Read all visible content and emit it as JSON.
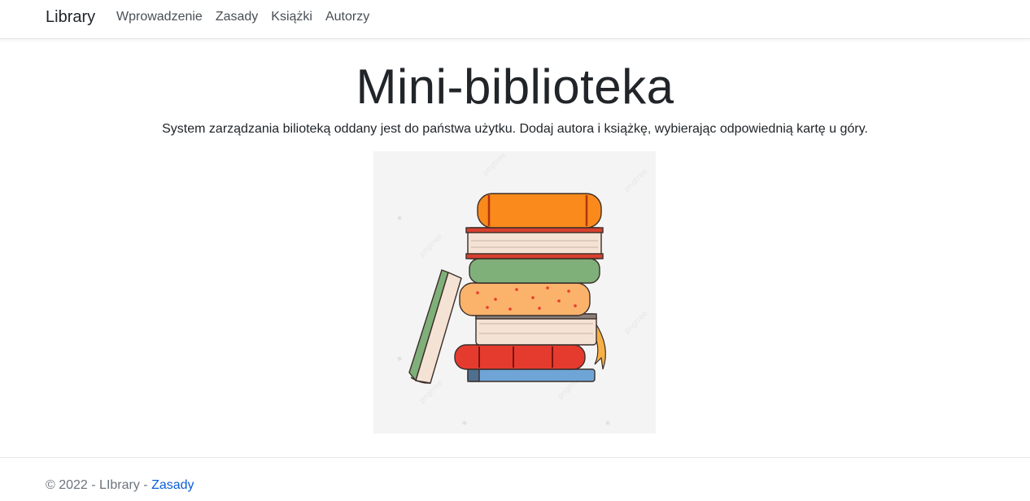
{
  "navbar": {
    "brand": "Library",
    "links": [
      {
        "label": "Wprowadzenie"
      },
      {
        "label": "Zasady"
      },
      {
        "label": "Książki"
      },
      {
        "label": "Autorzy"
      }
    ]
  },
  "main": {
    "title": "Mini-biblioteka",
    "lead": "System zarządzania bilioteką oddany jest do państwa użytku. Dodaj autora i książkę, wybierając odpowiednią kartę u góry.",
    "image": {
      "watermark": "pngtree",
      "colors": {
        "background": "#f4f4f4",
        "orange": "#f98a1b",
        "green": "#7fb07a",
        "peach": "#fbb26a",
        "red": "#e53b2e",
        "blue": "#6fa5d6",
        "pages": "#f4e2d4"
      }
    }
  },
  "footer": {
    "text": "© 2022 - LIbrary - ",
    "link_label": "Zasady"
  }
}
